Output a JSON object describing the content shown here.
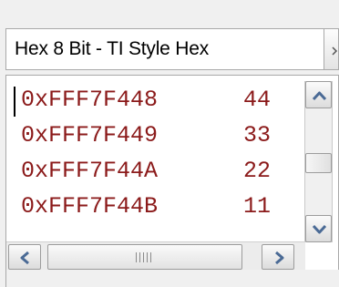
{
  "format_select": {
    "selected": "Hex 8 Bit - TI Style Hex"
  },
  "memory": {
    "rows": [
      {
        "address": "0xFFF7F448",
        "value": "44"
      },
      {
        "address": "0xFFF7F449",
        "value": "33"
      },
      {
        "address": "0xFFF7F44A",
        "value": "22"
      },
      {
        "address": "0xFFF7F44B",
        "value": "11"
      }
    ]
  },
  "colors": {
    "memory_text": "#8b1a1a",
    "scroll_arrow": "#4a6a95"
  },
  "icons": {
    "combo_dropdown": "chevron-down-icon",
    "scroll_up": "arrow-up-icon",
    "scroll_down": "arrow-down-icon",
    "scroll_left": "arrow-left-icon",
    "scroll_right": "arrow-right-icon"
  }
}
